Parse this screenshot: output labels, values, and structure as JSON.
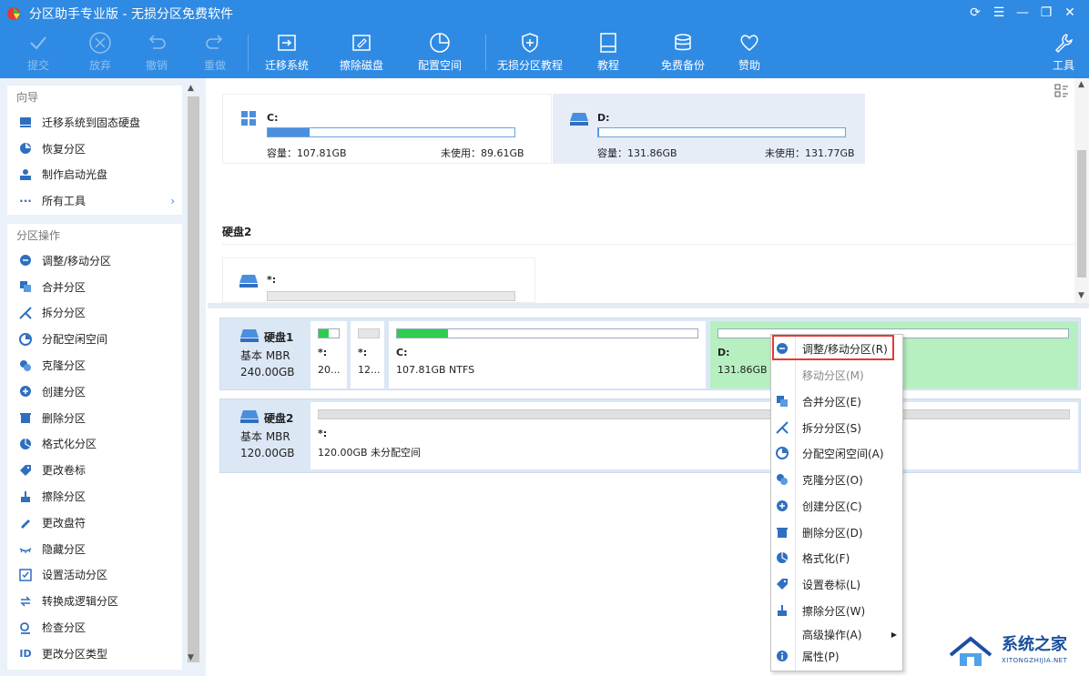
{
  "window": {
    "title": "分区助手专业版 - 无损分区免费软件"
  },
  "toolbar": {
    "items": [
      {
        "label": "提交",
        "icon": "check-icon",
        "enabled": false
      },
      {
        "label": "放弃",
        "icon": "cancel-circle-icon",
        "enabled": false
      },
      {
        "label": "撤销",
        "icon": "undo-icon",
        "enabled": false
      },
      {
        "label": "重做",
        "icon": "redo-icon",
        "enabled": false
      },
      {
        "label": "迁移系统",
        "icon": "migrate-icon",
        "enabled": true
      },
      {
        "label": "擦除磁盘",
        "icon": "wipe-disk-icon",
        "enabled": true
      },
      {
        "label": "配置空间",
        "icon": "allocate-space-icon",
        "enabled": true
      },
      {
        "label": "无损分区教程",
        "icon": "shield-icon",
        "enabled": true
      },
      {
        "label": "教程",
        "icon": "book-icon",
        "enabled": true
      },
      {
        "label": "免费备份",
        "icon": "backup-icon",
        "enabled": true
      },
      {
        "label": "赞助",
        "icon": "heart-icon",
        "enabled": true
      },
      {
        "label": "工具",
        "icon": "wrench-icon",
        "enabled": true
      }
    ]
  },
  "sidebar": {
    "wizard": {
      "title": "向导",
      "items": [
        {
          "label": "迁移系统到固态硬盘",
          "icon": "migrate-ssd-icon"
        },
        {
          "label": "恢复分区",
          "icon": "recover-partition-icon"
        },
        {
          "label": "制作启动光盘",
          "icon": "bootable-media-icon"
        },
        {
          "label": "所有工具",
          "icon": "more-icon"
        }
      ]
    },
    "operations": {
      "title": "分区操作",
      "items": [
        {
          "label": "调整/移动分区",
          "icon": "resize-partition-icon"
        },
        {
          "label": "合并分区",
          "icon": "merge-partition-icon"
        },
        {
          "label": "拆分分区",
          "icon": "split-partition-icon"
        },
        {
          "label": "分配空闲空间",
          "icon": "allocate-free-space-icon"
        },
        {
          "label": "克隆分区",
          "icon": "clone-partition-icon"
        },
        {
          "label": "创建分区",
          "icon": "create-partition-icon"
        },
        {
          "label": "删除分区",
          "icon": "delete-partition-icon"
        },
        {
          "label": "格式化分区",
          "icon": "format-partition-icon"
        },
        {
          "label": "更改卷标",
          "icon": "label-tag-icon"
        },
        {
          "label": "擦除分区",
          "icon": "wipe-partition-icon"
        },
        {
          "label": "更改盘符",
          "icon": "change-letter-icon"
        },
        {
          "label": "隐藏分区",
          "icon": "hide-partition-icon"
        },
        {
          "label": "设置活动分区",
          "icon": "set-active-icon"
        },
        {
          "label": "转换成逻辑分区",
          "icon": "convert-logical-icon"
        },
        {
          "label": "检查分区",
          "icon": "check-partition-icon"
        },
        {
          "label": "更改分区类型",
          "icon": "id-icon"
        }
      ]
    }
  },
  "upper": {
    "cards": [
      {
        "letter": "C:",
        "capacity": "容量：107.81GB",
        "free": "未使用：89.61GB",
        "usage": 0.17,
        "selected": false
      },
      {
        "letter": "D:",
        "capacity": "容量：131.86GB",
        "free": "未使用：131.77GB",
        "usage": 0.001,
        "selected": true
      }
    ],
    "disk2_label": "硬盘2",
    "disk2_card": {
      "letter": "*:"
    }
  },
  "disks": [
    {
      "name": "硬盘1",
      "type": "基本 MBR",
      "size": "240.00GB",
      "partitions": [
        {
          "letter": "*:",
          "info": "20...",
          "usage": 0.5
        },
        {
          "letter": "*:",
          "info": "12...",
          "usage": 0.0
        },
        {
          "letter": "C:",
          "info": "107.81GB NTFS",
          "usage": 0.17
        },
        {
          "letter": "D:",
          "info": "131.86GB NT",
          "usage": 0.0
        }
      ]
    },
    {
      "name": "硬盘2",
      "type": "基本 MBR",
      "size": "120.00GB",
      "partitions": [
        {
          "letter": "*:",
          "info": "120.00GB 未分配空间",
          "usage": 0.0
        }
      ]
    }
  ],
  "context_menu": {
    "items": [
      {
        "label": "调整/移动分区(R)",
        "icon": "resize-partition-icon",
        "enabled": true
      },
      {
        "label": "移动分区(M)",
        "icon": "",
        "enabled": false
      },
      {
        "label": "合并分区(E)",
        "icon": "merge-partition-icon",
        "enabled": true
      },
      {
        "label": "拆分分区(S)",
        "icon": "split-partition-icon",
        "enabled": true
      },
      {
        "label": "分配空闲空间(A)",
        "icon": "allocate-free-space-icon",
        "enabled": true
      },
      {
        "label": "克隆分区(O)",
        "icon": "clone-partition-icon",
        "enabled": true
      },
      {
        "label": "创建分区(C)",
        "icon": "create-partition-icon",
        "enabled": true
      },
      {
        "label": "删除分区(D)",
        "icon": "delete-partition-icon",
        "enabled": true
      },
      {
        "label": "格式化(F)",
        "icon": "format-partition-icon",
        "enabled": true
      },
      {
        "label": "设置卷标(L)",
        "icon": "label-tag-icon",
        "enabled": true
      },
      {
        "label": "擦除分区(W)",
        "icon": "wipe-partition-icon",
        "enabled": true
      },
      {
        "label": "高级操作(A)",
        "icon": "",
        "enabled": true,
        "submenu": true
      },
      {
        "label": "属性(P)",
        "icon": "info-icon",
        "enabled": true
      }
    ]
  },
  "watermark": {
    "name": "系统之家",
    "url": "XITONGZHIJIA.NET"
  },
  "colors": {
    "accent": "#2f8ae3",
    "selected_partition": "#b6f0c0",
    "used_bar": "#2fcc52",
    "highlight_box": "#e53935"
  }
}
